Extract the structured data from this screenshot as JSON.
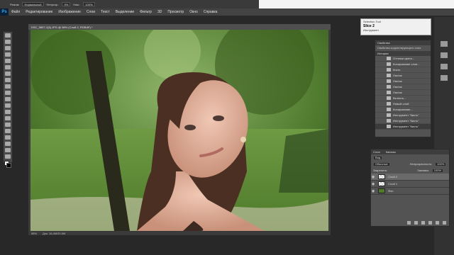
{
  "app": {
    "logo": "Ps"
  },
  "menu": [
    "Файл",
    "Редактирование",
    "Изображение",
    "Слои",
    "Текст",
    "Выделение",
    "Фильтр",
    "3D",
    "Просмотр",
    "Окно",
    "Справка"
  ],
  "options": {
    "mode_label": "Режим:",
    "mode_value": "Нормальный",
    "opacity_label": "Непрозр.:",
    "opacity_value": "9%",
    "flow_label": "Наж.:",
    "flow_value": "100%"
  },
  "document": {
    "tab_title": "DSC_9807-1(6).JPG @ 58% (Слой 2, RGB/8*) *",
    "zoom": "58%",
    "doc_size": "Док: 16,4M/20,9M"
  },
  "char_panel": {
    "title": "Selection Tool",
    "value": "Slice 2",
    "sub": "Инструмент"
  },
  "properties": {
    "tab": "Свойства",
    "note": "Свойства корректирующего слоя"
  },
  "history": {
    "tab": "История",
    "items": [
      "Оттенки цвета...",
      "Копирование слоя...",
      "Кисть",
      "Ластик",
      "Ластик",
      "Ластик",
      "Ластик",
      "Вклеить...",
      "Новый слой",
      "Копирование...",
      "Инструмент \"Кисть\"",
      "Инструмент \"Кисть\"",
      "Инструмент \"Кисть\""
    ]
  },
  "layers": {
    "tab": "Слои",
    "tab2": "Каналы",
    "filter_label": "Вид",
    "blend": "Обычные",
    "opacity_label": "Непрозрачность:",
    "opacity_value": "100%",
    "lock_label": "Закрепить:",
    "fill_label": "Заливка:",
    "fill_value": "100%",
    "rows": [
      "Слой 2",
      "Слой 1",
      "Фон"
    ]
  }
}
